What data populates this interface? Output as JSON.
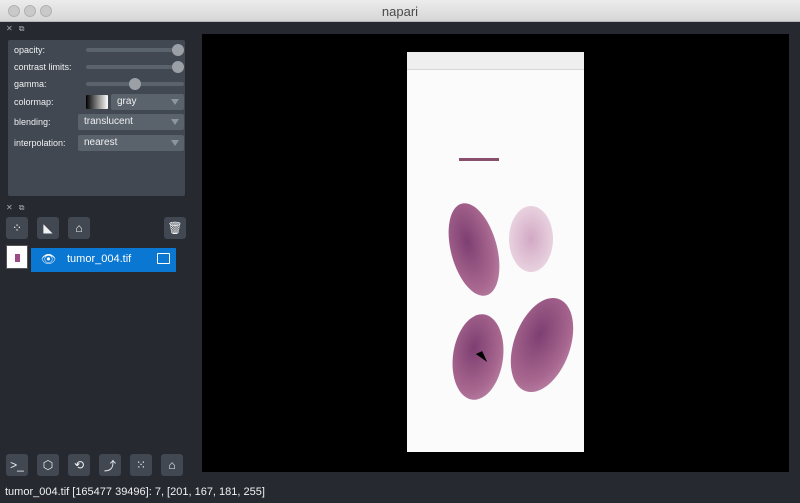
{
  "window": {
    "title": "napari"
  },
  "layer_controls": {
    "opacity_label": "opacity:",
    "opacity_value": 1.0,
    "contrast_label": "contrast limits:",
    "contrast_value": [
      0.9,
      1.0
    ],
    "gamma_label": "gamma:",
    "gamma_value": 0.5,
    "colormap_label": "colormap:",
    "colormap_value": "gray",
    "blending_label": "blending:",
    "blending_value": "translucent",
    "interpolation_label": "interpolation:",
    "interpolation_value": "nearest"
  },
  "layer_list": {
    "items": [
      {
        "name": "tumor_004.tif",
        "visible": true,
        "selected": true
      }
    ]
  },
  "toolbar_icons": [
    "points-icon",
    "shapes-icon",
    "labels-icon",
    "delete-icon"
  ],
  "bottom_buttons": [
    "console-icon",
    "3d-icon",
    "roll-icon",
    "transpose-icon",
    "grid-icon",
    "home-icon"
  ],
  "status": {
    "text": "tumor_004.tif [165477  39496]: 7, [201, 167, 181, 255]"
  },
  "colors": {
    "panel_bg": "#262930",
    "control_bg": "#414851",
    "selected": "#0a77d2"
  }
}
